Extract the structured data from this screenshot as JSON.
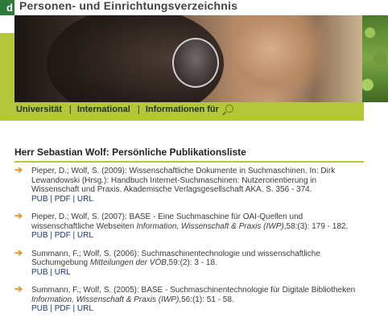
{
  "header": {
    "logo_text": "d",
    "title": "Personen- und Einrichtungsverzeichnis"
  },
  "nav": {
    "items": [
      "Universität",
      "International",
      "Informationen für"
    ],
    "separator": "|"
  },
  "page": {
    "title": "Herr Sebastian Wolf: Persönliche Publikationsliste"
  },
  "publications": [
    {
      "text": "Pieper, D.; Wolf, S. (2009): Wissenschaftliche Dokumente in Suchmaschinen. In: Dirk Lewandowski (Hrsg.): Handbuch Internet-Suchmaschinen: Nutzerorientierung in Wissenschaft und Praxis. Akademische Verlagsgesellschaft AKA. S. 356 - 374.",
      "source": "",
      "tail": "",
      "links": [
        "PUB",
        "PDF",
        "URL"
      ]
    },
    {
      "text": "Pieper, D.; Wolf, S. (2007): BASE - Eine Suchmaschine für OAI-Quellen und wissenschaftliche Webseiten ",
      "source": "Information, Wissenschaft & Praxis (IWP)",
      "tail": ",58:(3): 179 - 182.",
      "links": [
        "PUB",
        "PDF",
        "URL"
      ]
    },
    {
      "text": "Summann, F.; Wolf, S. (2006): Suchmaschinentechnologie und wissenschaftliche Suchumgebung ",
      "source": "Mitteilungen der VÖB",
      "tail": ",59:(2): 3 - 18.",
      "links": [
        "PUB",
        "URL"
      ]
    },
    {
      "text": "Summann, F.; Wolf, S. (2005): BASE - Suchmaschinentechnologie für Digitale Bibliotheken ",
      "source": "Information, Wissenschaft & Praxis (IWP)",
      "tail": ",56:(1): 51 - 58.",
      "links": [
        "PUB",
        "PDF",
        "URL"
      ]
    }
  ],
  "colors": {
    "accent": "#b3c738",
    "arrow": "#e8932a",
    "link": "#1a3a7a"
  }
}
